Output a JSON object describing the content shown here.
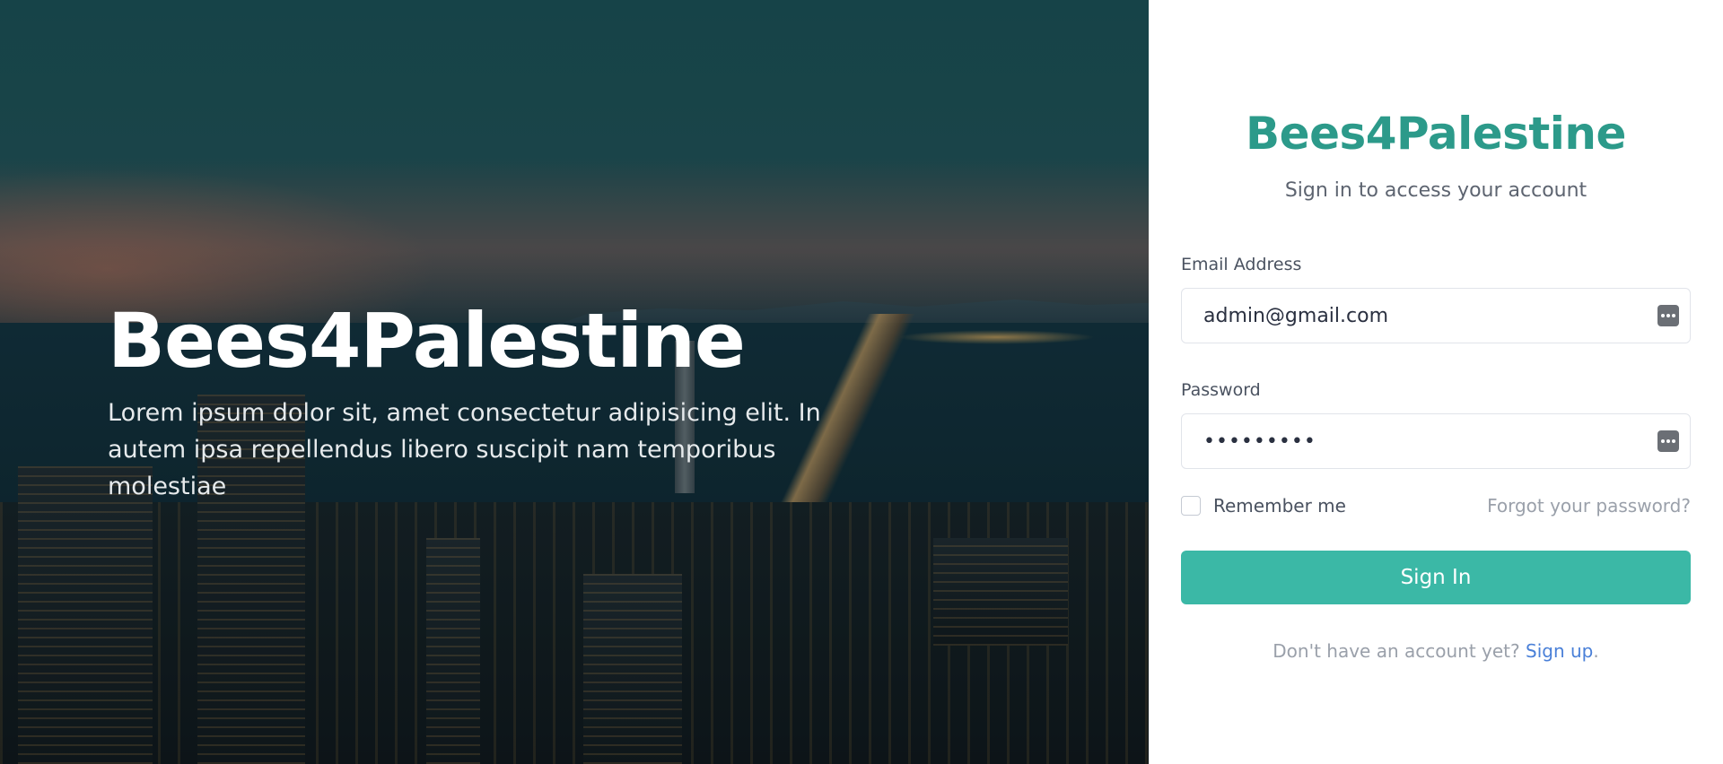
{
  "hero": {
    "title": "Bees4Palestine",
    "description": "Lorem ipsum dolor sit, amet consectetur adipisicing elit. In autem ipsa repellendus libero suscipit nam temporibus molestiae"
  },
  "login": {
    "brand": "Bees4Palestine",
    "subtitle": "Sign in to access your account",
    "email": {
      "label": "Email Address",
      "value": "admin@gmail.com",
      "icon": "password-manager-icon"
    },
    "password": {
      "label": "Password",
      "value": "•••••••••",
      "icon": "password-manager-icon"
    },
    "remember_label": "Remember me",
    "remember_checked": false,
    "forgot_label": "Forgot your password?",
    "submit_label": "Sign In",
    "signup_prompt": "Don't have an account yet?",
    "signup_link": "Sign up",
    "signup_suffix": "."
  },
  "colors": {
    "brand": "#2c9a8a",
    "button": "#3bb8a6",
    "link": "#4a80d8",
    "muted_text": "#9aa0aa"
  }
}
